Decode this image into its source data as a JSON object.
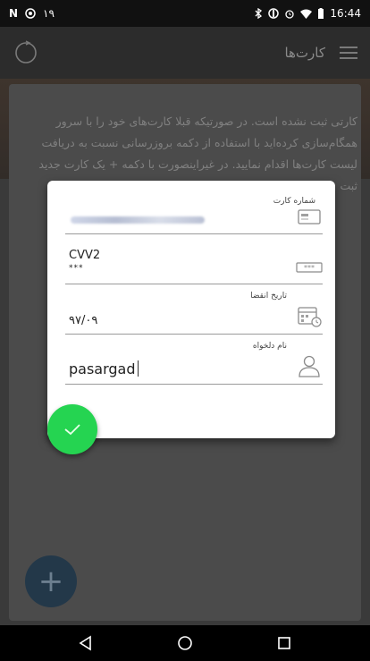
{
  "status_bar": {
    "time": "16:44",
    "notification_count": "۱۹",
    "icons": [
      "n-icon",
      "whatsapp-icon",
      "bluetooth-icon",
      "data-icon",
      "alarm-icon",
      "wifi-icon",
      "battery-icon"
    ]
  },
  "app_bar": {
    "title": "کارت‌ها",
    "left_icon": "refresh-icon",
    "right_icon": "menu-icon"
  },
  "info_text": "کارتی ثبت نشده است. در صورتیکه قبلا کارت‌های خود را با سرور همگام‌سازی کرده‌اید با استفاده از دکمه بروزرسانی نسبت به دریافت لیست کارت‌ها اقدام نمایید. در غیراینصورت با دکمه + یک کارت جدید ثبت",
  "dialog": {
    "card_number": {
      "label": "شماره کارت",
      "value_masked": true,
      "icon": "credit-card-icon"
    },
    "cvv": {
      "title": "CVV2",
      "value": "***",
      "icon": "cvv-box-icon"
    },
    "expiry": {
      "label": "تاریخ انقضا",
      "value": "۹۷/۰۹",
      "icon": "calendar-clock-icon"
    },
    "nickname": {
      "label": "نام دلخواه",
      "value": "pasargad",
      "icon": "user-icon"
    }
  },
  "buttons": {
    "confirm_icon": "check-icon",
    "add_label": "+"
  },
  "colors": {
    "confirm_green": "#25d451",
    "fab_dark": "#233849",
    "overlay": "#3a3a3a"
  }
}
